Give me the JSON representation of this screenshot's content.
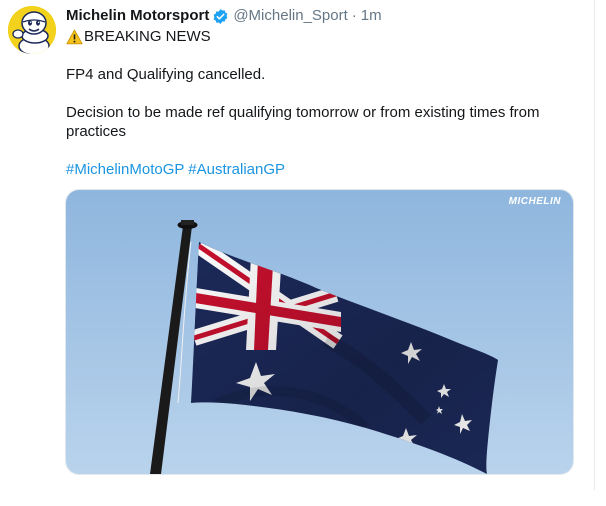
{
  "tweet": {
    "author_name": "Michelin Motorsport",
    "handle": "@Michelin_Sport",
    "separator": "·",
    "time": "1m",
    "verified": true,
    "lines": {
      "breaking": "BREAKING NEWS",
      "headline": "FP4 and Qualifying cancelled.",
      "decision": "Decision to be made ref qualifying tomorrow or from existing times from practices"
    },
    "hashtags": [
      "#MichelinMotoGP",
      "#AustralianGP"
    ],
    "media": {
      "subject": "Australian flag on a flagpole against blue sky",
      "watermark": "MICHELIN"
    }
  },
  "icons": {
    "avatar": "michelin-bibendum-avatar",
    "verified": "verified-badge-icon",
    "warning": "warning-icon"
  },
  "colors": {
    "text": "#14171a",
    "secondary": "#657786",
    "link": "#1b95e0",
    "verified": "#1da1f2",
    "avatar_bg": "#f2d21c",
    "sky": "#a9c8e6",
    "flag_blue": "#1c2a5a",
    "flag_red": "#c8102e"
  }
}
